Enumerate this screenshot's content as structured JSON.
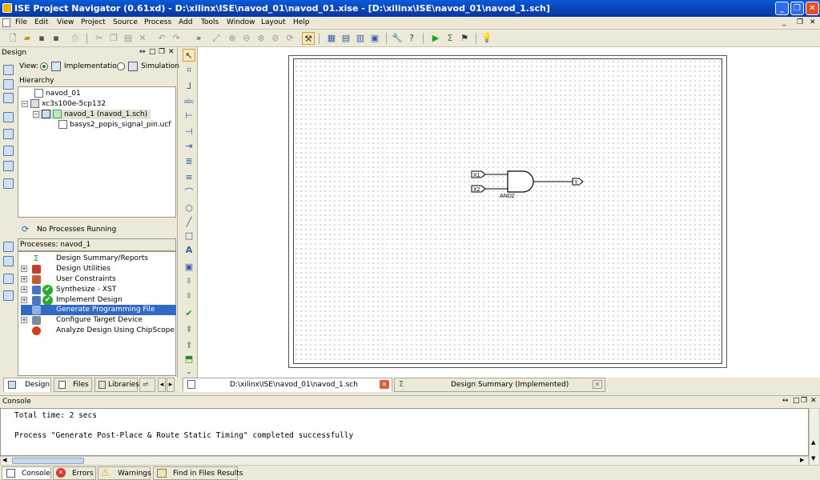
{
  "window": {
    "title": "ISE Project Navigator (0.61xd) - D:\\xilinx\\ISE\\navod_01\\navod_01.xise - [D:\\xilinx\\ISE\\navod_01\\navod_1.sch]",
    "controls": [
      "_",
      "❐",
      "✕"
    ]
  },
  "menu": [
    "File",
    "Edit",
    "View",
    "Project",
    "Source",
    "Process",
    "Add",
    "Tools",
    "Window",
    "Layout",
    "Help"
  ],
  "design_panel": {
    "title": "Design",
    "view_label": "View:",
    "view_options": [
      "Implementation",
      "Simulation"
    ],
    "hierarchy_label": "Hierarchy",
    "tree": [
      {
        "label": "navod_01"
      },
      {
        "label": "xc3s100e-5cp132"
      },
      {
        "label": "navod_1 (navod_1.sch)"
      },
      {
        "label": "basys2_popis_signal_pin.ucf"
      }
    ],
    "status": "No Processes Running",
    "processes_label": "Processes: navod_1",
    "processes": [
      {
        "label": "Design Summary/Reports"
      },
      {
        "label": "Design Utilities"
      },
      {
        "label": "User Constraints"
      },
      {
        "label": "Synthesize - XST"
      },
      {
        "label": "Implement Design"
      },
      {
        "label": "Generate Programming File"
      },
      {
        "label": "Configure Target Device"
      },
      {
        "label": "Analyze Design Using ChipScope"
      }
    ],
    "tabs": [
      "Design",
      "Files",
      "Libraries"
    ]
  },
  "schematic": {
    "inputs": [
      "X1",
      "X2"
    ],
    "output": "Y",
    "gate_label": "AND2"
  },
  "editor_tabs": [
    {
      "label": "D:\\xilinx\\ISE\\navod_01\\navod_1.sch"
    },
    {
      "label": "Design Summary (Implemented)"
    }
  ],
  "console": {
    "title": "Console",
    "lines": [
      "Total time: 2 secs",
      "",
      "Process \"Generate Post-Place & Route Static Timing\" completed successfully"
    ],
    "tabs": [
      "Console",
      "Errors",
      "Warnings",
      "Find in Files Results"
    ]
  },
  "colors": {
    "titlebar": "#0842b5",
    "selection": "#316ac5",
    "success": "#2fa82f",
    "error": "#d9372b",
    "warning": "#f2c300"
  }
}
